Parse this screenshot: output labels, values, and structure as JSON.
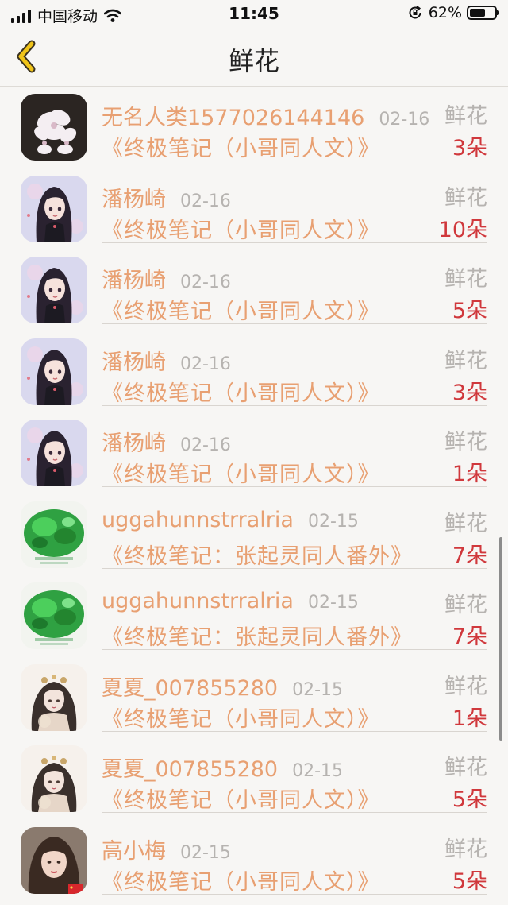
{
  "status_bar": {
    "carrier": "中国移动",
    "time": "11:45",
    "battery_percent": "62%",
    "battery_level": 0.62
  },
  "nav": {
    "title": "鲜花",
    "back_icon": "chevron-left-icon",
    "accent_color": "#f0c419"
  },
  "colors": {
    "name": "#e8a072",
    "meta": "#b6b3b0",
    "count": "#d0383c"
  },
  "items": [
    {
      "name": "无名人类1577026144146",
      "date": "02-16",
      "type": "鲜花",
      "book": "《终极笔记（小哥同人文）》",
      "count": "3朵",
      "avatar": "orchid-avatar"
    },
    {
      "name": "潘杨崎",
      "date": "02-16",
      "type": "鲜花",
      "book": "《终极笔记（小哥同人文）》",
      "count": "10朵",
      "avatar": "anime-girl-avatar"
    },
    {
      "name": "潘杨崎",
      "date": "02-16",
      "type": "鲜花",
      "book": "《终极笔记（小哥同人文）》",
      "count": "5朵",
      "avatar": "anime-girl-avatar"
    },
    {
      "name": "潘杨崎",
      "date": "02-16",
      "type": "鲜花",
      "book": "《终极笔记（小哥同人文）》",
      "count": "3朵",
      "avatar": "anime-girl-avatar"
    },
    {
      "name": "潘杨崎",
      "date": "02-16",
      "type": "鲜花",
      "book": "《终极笔记（小哥同人文）》",
      "count": "1朵",
      "avatar": "anime-girl-avatar"
    },
    {
      "name": "uggahunnstrralria",
      "date": "02-15",
      "type": "鲜花",
      "book": "《终极笔记：张起灵同人番外》",
      "count": "7朵",
      "avatar": "jade-avatar"
    },
    {
      "name": "uggahunnstrralria",
      "date": "02-15",
      "type": "鲜花",
      "book": "《终极笔记：张起灵同人番外》",
      "count": "7朵",
      "avatar": "jade-avatar"
    },
    {
      "name": "夏夏_007855280",
      "date": "02-15",
      "type": "鲜花",
      "book": "《终极笔记（小哥同人文）》",
      "count": "1朵",
      "avatar": "ancient-beauty-avatar"
    },
    {
      "name": "夏夏_007855280",
      "date": "02-15",
      "type": "鲜花",
      "book": "《终极笔记（小哥同人文）》",
      "count": "5朵",
      "avatar": "ancient-beauty-avatar"
    },
    {
      "name": "高小梅",
      "date": "02-15",
      "type": "鲜花",
      "book": "《终极笔记（小哥同人文）》",
      "count": "5朵",
      "avatar": "photo-avatar"
    }
  ]
}
